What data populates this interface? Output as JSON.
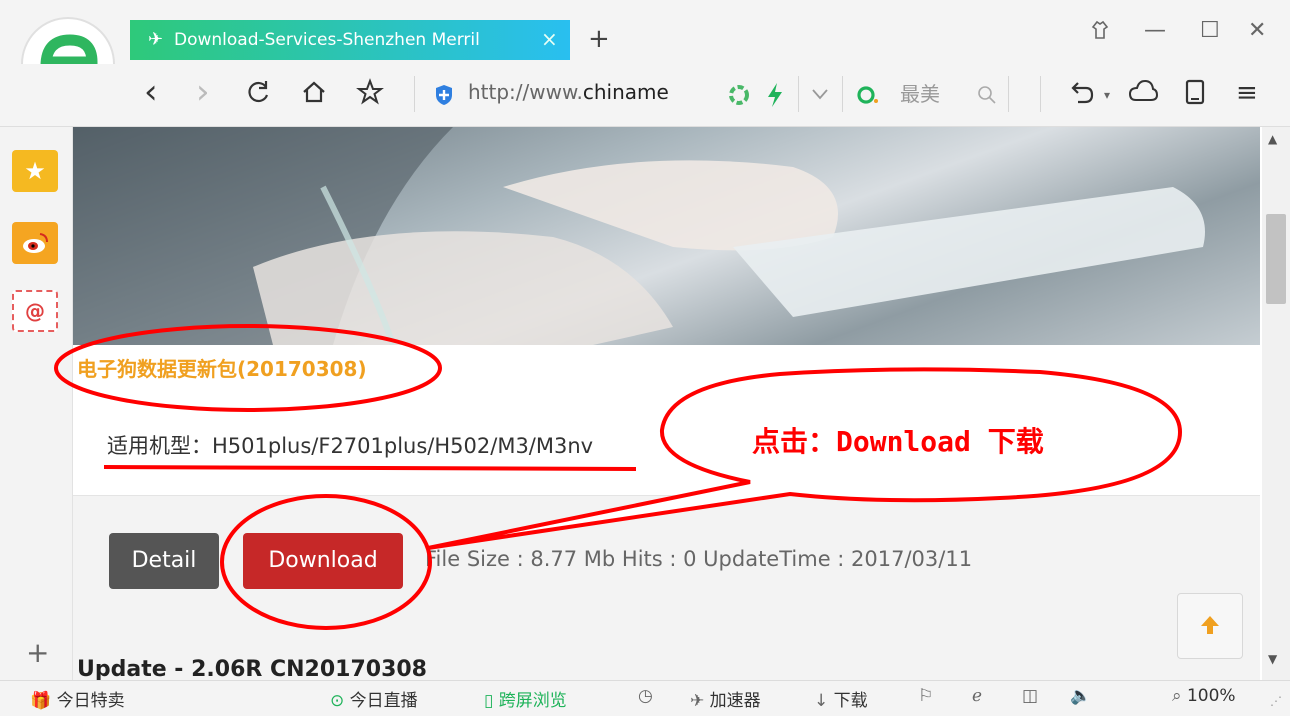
{
  "tab": {
    "title": "Download-Services-Shenzhen Merril",
    "close_label": "×",
    "new_tab_label": "+"
  },
  "window_controls": {
    "skin_label": "🎗",
    "minimize_label": "—",
    "maximize_label": "☐",
    "close_label": "✕"
  },
  "nav": {
    "back_label": "‹",
    "forward_label": "›",
    "reload_label": "C",
    "home_label": "⌂",
    "favorite_label": "☆",
    "address_prefix": "http://www.",
    "address_domain": "chiname",
    "search_text": "最美",
    "search_icon_label": "⌕",
    "undo_label": "↶",
    "cloud_label": "☁",
    "menu_label": "≡"
  },
  "sidebar": {
    "add_label": "+"
  },
  "content": {
    "package_title": "电子狗数据更新包(20170308)",
    "models_text": "适用机型：H501plus/F2701plus/H502/M3/M3nv",
    "detail_label": "Detail",
    "download_label": "Download",
    "file_info": "File Size : 8.77 Mb    Hits : 0    UpdateTime : 2017/03/11",
    "back_to_top_label": "🡅",
    "next_item_partial": "Update - 2.06R CN20170308"
  },
  "annotation": {
    "callout_text": "点击：Download 下载"
  },
  "statusbar": {
    "deals_label": "今日特卖",
    "live_label": "今日直播",
    "cross_screen_label": "跨屏浏览",
    "accelerator_label": "加速器",
    "download_label": "下载",
    "zoom_label": "100%"
  },
  "colors": {
    "tab_gradient_start": "#2ec97a",
    "tab_gradient_end": "#29bff0",
    "title_orange": "#f0a020",
    "download_red": "#c62828",
    "detail_gray": "#555555",
    "annotation_red": "#ff0000"
  }
}
